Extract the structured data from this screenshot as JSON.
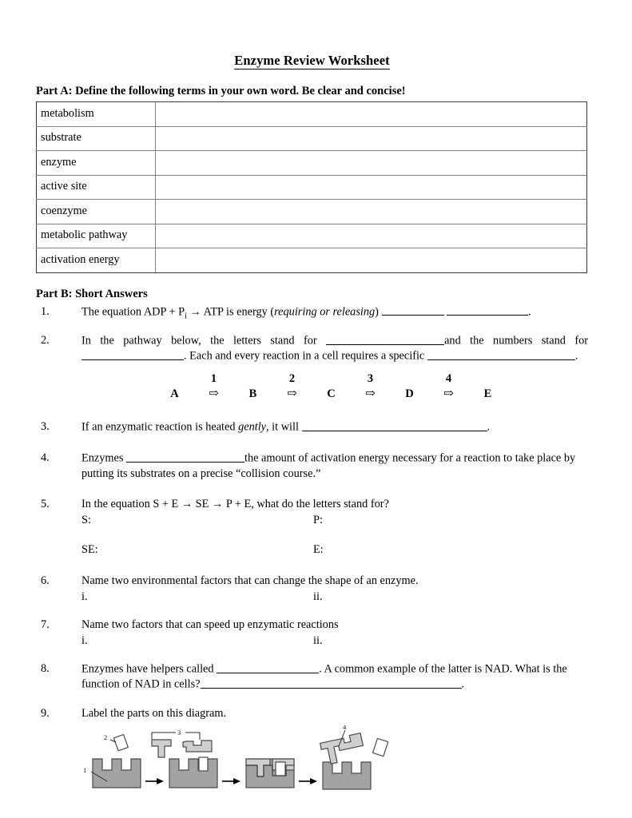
{
  "document": {
    "title": "Enzyme Review Worksheet"
  },
  "part_a": {
    "heading": "Part A:  Define the following terms in your own word.  Be clear and concise!",
    "terms": [
      {
        "term": "metabolism",
        "definition": ""
      },
      {
        "term": "substrate",
        "definition": ""
      },
      {
        "term": "enzyme",
        "definition": ""
      },
      {
        "term": "active site",
        "definition": ""
      },
      {
        "term": "coenzyme",
        "definition": ""
      },
      {
        "term": "metabolic pathway",
        "definition": ""
      },
      {
        "term": "activation energy",
        "definition": ""
      }
    ]
  },
  "part_b": {
    "heading": "Part B:  Short Answers",
    "questions": {
      "q1": {
        "num": "1.",
        "t1": "The equation ADP + P",
        "sub": "i",
        "t2": " ",
        "arrow": "→",
        "t3": "  ATP is energy (",
        "ital": "requiring or releasing",
        "t4": ") ",
        "t5": " ",
        "t6": "."
      },
      "q2": {
        "num": "2.",
        "t1": "In the pathway below, the letters stand for ",
        "t2": "and the numbers stand for ",
        "t3": ".  Each and every reaction in a cell requires a specific ",
        "t4": ".",
        "pathway": {
          "numbers": [
            "1",
            "2",
            "3",
            "4"
          ],
          "letters": [
            "A",
            "B",
            "C",
            "D",
            "E"
          ],
          "arrow": "⇨"
        }
      },
      "q3": {
        "num": "3.",
        "t1": "If an enzymatic reaction is heated ",
        "ital": "gently",
        "t2": ", it will ",
        "t3": "."
      },
      "q4": {
        "num": "4.",
        "t1": "Enzymes ",
        "t2": "the amount of activation energy necessary for a reaction to take place by putting its substrates on a precise “collision course.”"
      },
      "q5": {
        "num": "5.",
        "t1": "In the equation S + E ",
        "arrow1": "→",
        "t2": " SE ",
        "arrow2": "→",
        "t3": " P + E, what do the letters stand for?",
        "label_s": "S:",
        "label_p": "P:",
        "label_se": "SE:",
        "label_e": "E:"
      },
      "q6": {
        "num": "6.",
        "t1": "Name two environmental factors that can change the shape of an enzyme.",
        "item_i": "i.",
        "item_ii": "ii."
      },
      "q7": {
        "num": "7.",
        "t1": "Name two factors that can speed up enzymatic reactions",
        "item_i": "i.",
        "item_ii": "ii."
      },
      "q8": {
        "num": "8.",
        "t1": "Enzymes have helpers called ",
        "t2": ".  A common example of the latter is NAD.  What is the function of NAD in cells?",
        "t3": "."
      },
      "q9": {
        "num": "9.",
        "t1": "Label the parts on this diagram.",
        "diagram": {
          "labels": [
            "1",
            "2",
            "3",
            "4"
          ],
          "enzyme_color": "#a3a3a3",
          "substrate_color": "#cfcfcf",
          "product_color": "#ffffff",
          "outline_color": "#4a4a4a",
          "arrow_color": "#000000",
          "panels": 4,
          "arrows": 3
        }
      }
    }
  }
}
